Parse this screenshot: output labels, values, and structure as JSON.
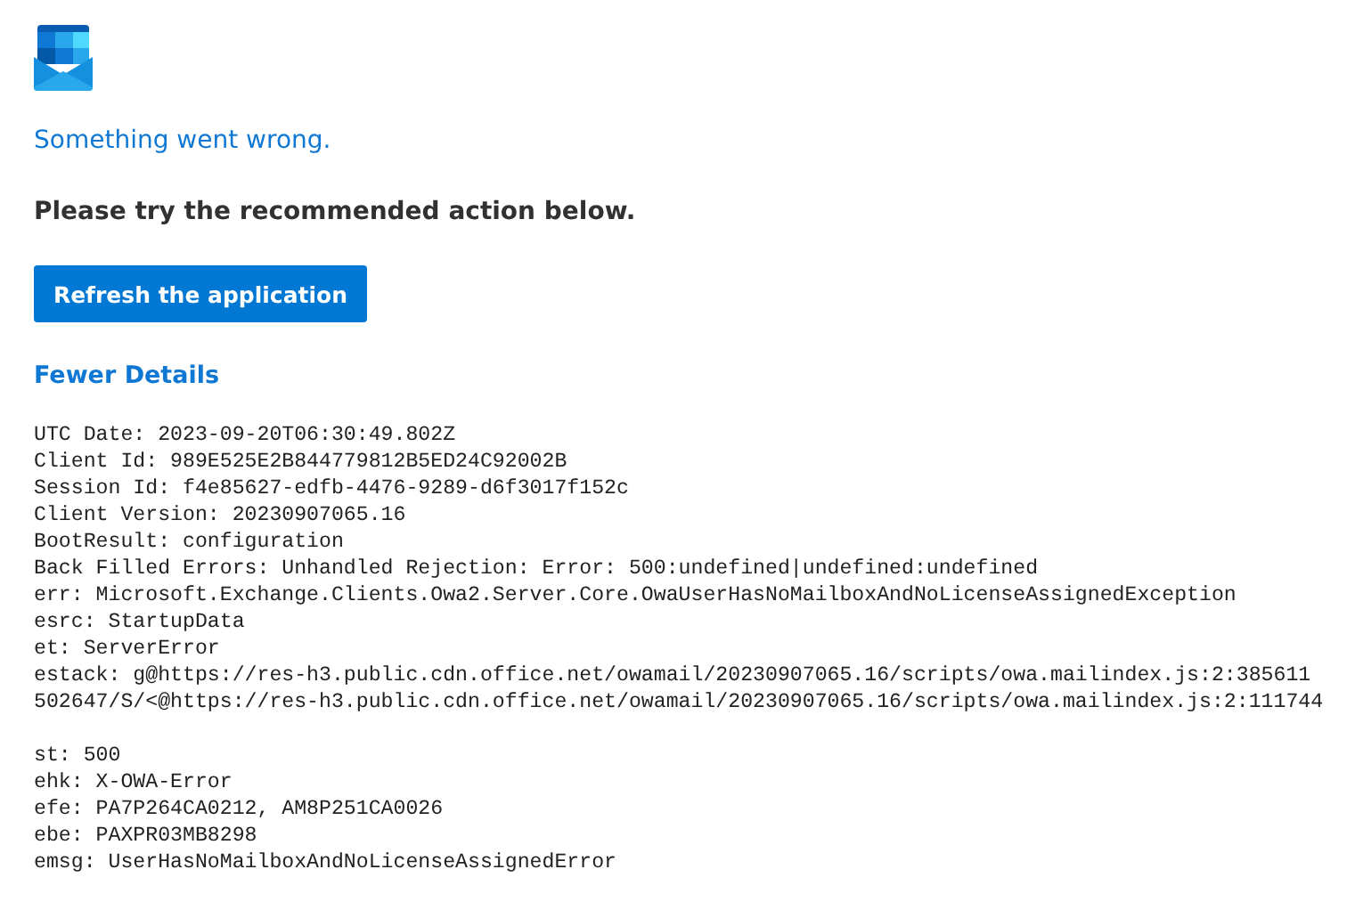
{
  "error_title": "Something went wrong.",
  "instruction": "Please try the recommended action below.",
  "action_button": "Refresh the application",
  "details_toggle": "Fewer Details",
  "detail_blocks": [
    [
      "UTC Date: 2023-09-20T06:30:49.802Z",
      "Client Id: 989E525E2B844779812B5ED24C92002B",
      "Session Id: f4e85627-edfb-4476-9289-d6f3017f152c",
      "Client Version: 20230907065.16",
      "BootResult: configuration",
      "Back Filled Errors: Unhandled Rejection: Error: 500:undefined|undefined:undefined",
      "err: Microsoft.Exchange.Clients.Owa2.Server.Core.OwaUserHasNoMailboxAndNoLicenseAssignedException",
      "esrc: StartupData",
      "et: ServerError",
      "estack: g@https://res-h3.public.cdn.office.net/owamail/20230907065.16/scripts/owa.mailindex.js:2:385611",
      "502647/S/<@https://res-h3.public.cdn.office.net/owamail/20230907065.16/scripts/owa.mailindex.js:2:111744"
    ],
    [
      "st: 500",
      "ehk: X-OWA-Error",
      "efe: PA7P264CA0212, AM8P251CA0026",
      "ebe: PAXPR03MB8298",
      "emsg: UserHasNoMailboxAndNoLicenseAssignedError"
    ]
  ]
}
